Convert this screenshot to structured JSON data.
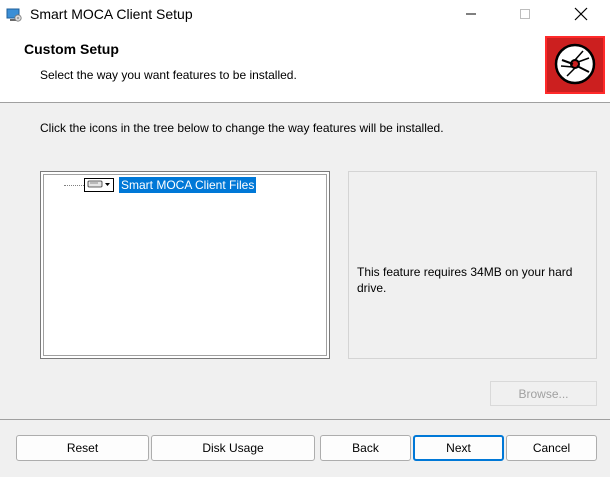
{
  "window": {
    "title": "Smart MOCA Client Setup",
    "controls": [
      "minimize-icon",
      "maximize-icon",
      "close-icon"
    ]
  },
  "header": {
    "title": "Custom Setup",
    "subtitle": "Select the way you want features to be installed."
  },
  "instruction": "Click the icons in the tree below to change the way features will be installed.",
  "tree": {
    "items": [
      {
        "label": "Smart MOCA Client Files",
        "selected": true,
        "icon": "drive-icon"
      }
    ]
  },
  "description": {
    "text": "This feature requires 34MB on your hard drive."
  },
  "buttons": {
    "browse": "Browse...",
    "reset": "Reset",
    "disk_usage": "Disk Usage",
    "back": "Back",
    "next": "Next",
    "cancel": "Cancel"
  },
  "colors": {
    "selection": "#0078d7",
    "logo_bg": "#cc1f1f",
    "logo_border": "#ff2a2a"
  }
}
